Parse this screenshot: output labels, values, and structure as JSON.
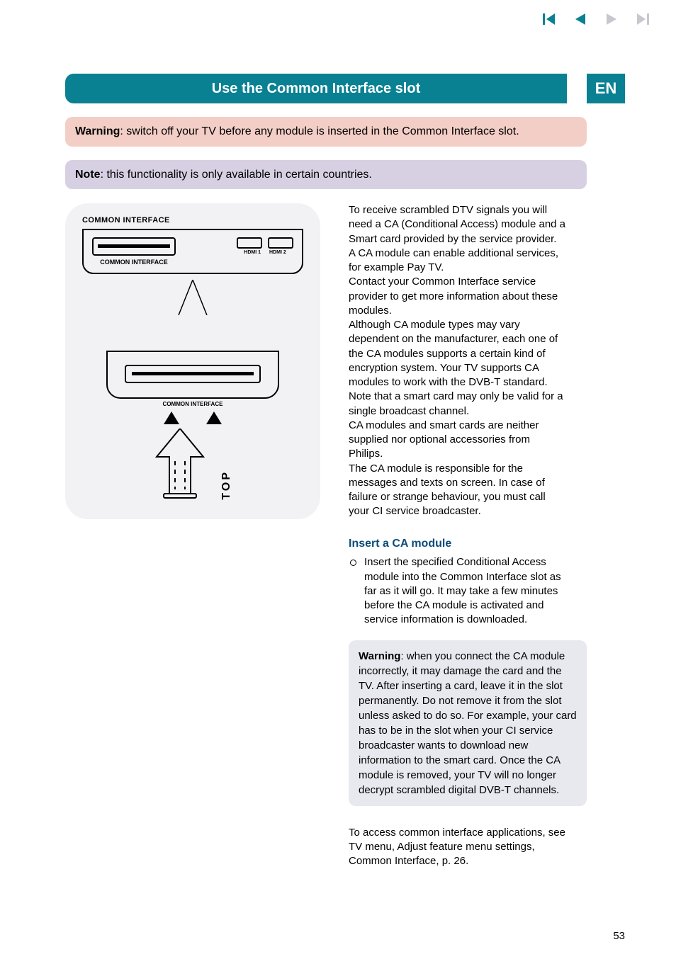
{
  "nav": {
    "prev_dim": "#c6c8cd",
    "next_dim": "#c6c8cd",
    "active": "#098193"
  },
  "heading": {
    "title": "Use the Common Interface slot",
    "lang": "EN"
  },
  "banners": {
    "warning_label": "Warning",
    "warning_text": ": switch off your TV before any module is inserted in the Common Interface slot.",
    "note_label": "Note",
    "note_text": ": this functionality is only available in certain countries."
  },
  "figure": {
    "panel_title": "COMMON INTERFACE",
    "ci_label": "COMMON INTERFACE",
    "hdmi1": "HDMI 1",
    "hdmi2": "HDMI 2",
    "ci_label2": "COMMON INTERFACE",
    "top": "TOP"
  },
  "body": {
    "p1": "To receive scrambled DTV signals you will need a CA (Conditional Access) module and a Smart card provided by the service provider.",
    "p2": "A CA module can enable additional services, for example Pay TV.",
    "p3": "Contact your Common Interface service provider to get more information about these modules.",
    "p4": "Although CA module types may vary dependent on the manufacturer, each one of the CA modules supports a certain kind of encryption system. Your TV supports CA modules to work with the DVB-T standard.",
    "p5": "Note that a smart card may only be valid for a single broadcast channel.",
    "p6": "CA modules and smart cards are neither supplied nor optional accessories from Philips.",
    "p7": "The CA module is responsible for the messages and texts on screen. In case of failure or strange behaviour, you must call your CI service broadcaster.",
    "insert_heading": "Insert a CA module",
    "insert_item": "Insert the specified Conditional Access module into the Common Interface slot as far as it will go. It may take a few minutes before the CA module is activated and service information is downloaded.",
    "warn2_label": "Warning",
    "warn2_text": ": when you connect the CA module incorrectly, it may damage the card and the TV. After inserting a card, leave it in the slot permanently. Do not remove it from the slot unless asked to do so. For example,  your card has to be in the slot when your CI service broadcaster wants to download new information to the smart card. Once the CA module is removed, your TV will no longer decrypt scrambled digital DVB-T channels.",
    "closing": "To access common interface applications, see TV menu, Adjust feature menu settings, Common Interface, p. 26."
  },
  "page_number": "53"
}
